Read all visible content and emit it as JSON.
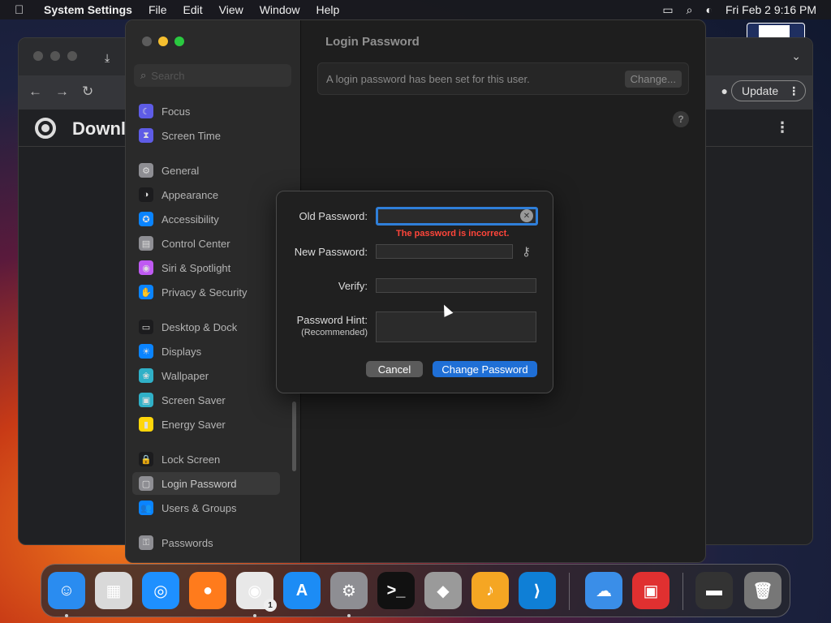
{
  "menubar": {
    "app_name": "System Settings",
    "items": [
      "File",
      "Edit",
      "View",
      "Window",
      "Help"
    ],
    "clock": "Fri Feb 2  9:16 PM"
  },
  "chrome": {
    "header_title": "Downl",
    "update_label": "Update"
  },
  "settings": {
    "search_placeholder": "Search",
    "sidebar_items": [
      {
        "label": "Focus",
        "icon": "moon-icon",
        "color": "#5e5ce6"
      },
      {
        "label": "Screen Time",
        "icon": "hourglass-icon",
        "color": "#5e5ce6"
      },
      {
        "label": "General",
        "icon": "gear-icon",
        "color": "#8e8e93"
      },
      {
        "label": "Appearance",
        "icon": "appearance-icon",
        "color": "#1c1c1e"
      },
      {
        "label": "Accessibility",
        "icon": "accessibility-icon",
        "color": "#0a84ff"
      },
      {
        "label": "Control Center",
        "icon": "control-center-icon",
        "color": "#8e8e93"
      },
      {
        "label": "Siri & Spotlight",
        "icon": "siri-icon",
        "color": "#bf5af2"
      },
      {
        "label": "Privacy & Security",
        "icon": "hand-icon",
        "color": "#0a84ff"
      },
      {
        "label": "Desktop & Dock",
        "icon": "dock-icon",
        "color": "#1c1c1e"
      },
      {
        "label": "Displays",
        "icon": "sun-icon",
        "color": "#0a84ff"
      },
      {
        "label": "Wallpaper",
        "icon": "wallpaper-icon",
        "color": "#30b0c7"
      },
      {
        "label": "Screen Saver",
        "icon": "screen-saver-icon",
        "color": "#30b0c7"
      },
      {
        "label": "Energy Saver",
        "icon": "battery-icon",
        "color": "#ffd60a"
      },
      {
        "label": "Lock Screen",
        "icon": "lock-icon",
        "color": "#1c1c1e"
      },
      {
        "label": "Login Password",
        "icon": "lock-password-icon",
        "color": "#8e8e93"
      },
      {
        "label": "Users & Groups",
        "icon": "users-icon",
        "color": "#0a84ff"
      },
      {
        "label": "Passwords",
        "icon": "key-icon",
        "color": "#8e8e93"
      }
    ],
    "selected_index": 14,
    "content_title": "Login Password",
    "info_text": "A login password has been set for this user.",
    "change_label": "Change..."
  },
  "dialog": {
    "old_password_label": "Old Password:",
    "error_text": "The password is incorrect.",
    "new_password_label": "New Password:",
    "verify_label": "Verify:",
    "hint_label": "Password Hint:",
    "hint_sub_label": "(Recommended)",
    "cancel_label": "Cancel",
    "change_password_label": "Change Password"
  },
  "dock": {
    "icons": [
      {
        "name": "finder-icon",
        "glyph": "☺",
        "color": "#2a8cf0",
        "running": true
      },
      {
        "name": "launchpad-icon",
        "glyph": "▦",
        "color": "#d9d9d9",
        "running": false
      },
      {
        "name": "safari-icon",
        "glyph": "◎",
        "color": "#1e90ff",
        "running": false
      },
      {
        "name": "firefox-icon",
        "glyph": "●",
        "color": "#ff7b1c",
        "running": false
      },
      {
        "name": "chrome-icon",
        "glyph": "◉",
        "color": "#e8e8e8",
        "running": true,
        "badge": "1"
      },
      {
        "name": "app-store-icon",
        "glyph": "A",
        "color": "#1c8cf5",
        "running": false
      },
      {
        "name": "system-settings-icon",
        "glyph": "⚙",
        "color": "#8e8e93",
        "running": true
      },
      {
        "name": "terminal-icon",
        "glyph": ">_",
        "color": "#111111",
        "running": false
      },
      {
        "name": "boot-camp-icon",
        "glyph": "◆",
        "color": "#9a9a9a",
        "running": false
      },
      {
        "name": "garageband-icon",
        "glyph": "♪",
        "color": "#f5a623",
        "running": false
      },
      {
        "name": "vscode-icon",
        "glyph": "⟩",
        "color": "#0f7fd6",
        "running": false
      },
      {
        "name": "weather-icon",
        "glyph": "☁",
        "color": "#3a8ee8",
        "running": false
      },
      {
        "name": "photo-booth-icon",
        "glyph": "▣",
        "color": "#e03030",
        "running": false
      },
      {
        "name": "downloads-stack-icon",
        "glyph": "▬",
        "color": "#333333",
        "running": false
      },
      {
        "name": "trash-icon",
        "glyph": "🗑",
        "color": "#777777",
        "running": false
      }
    ]
  }
}
